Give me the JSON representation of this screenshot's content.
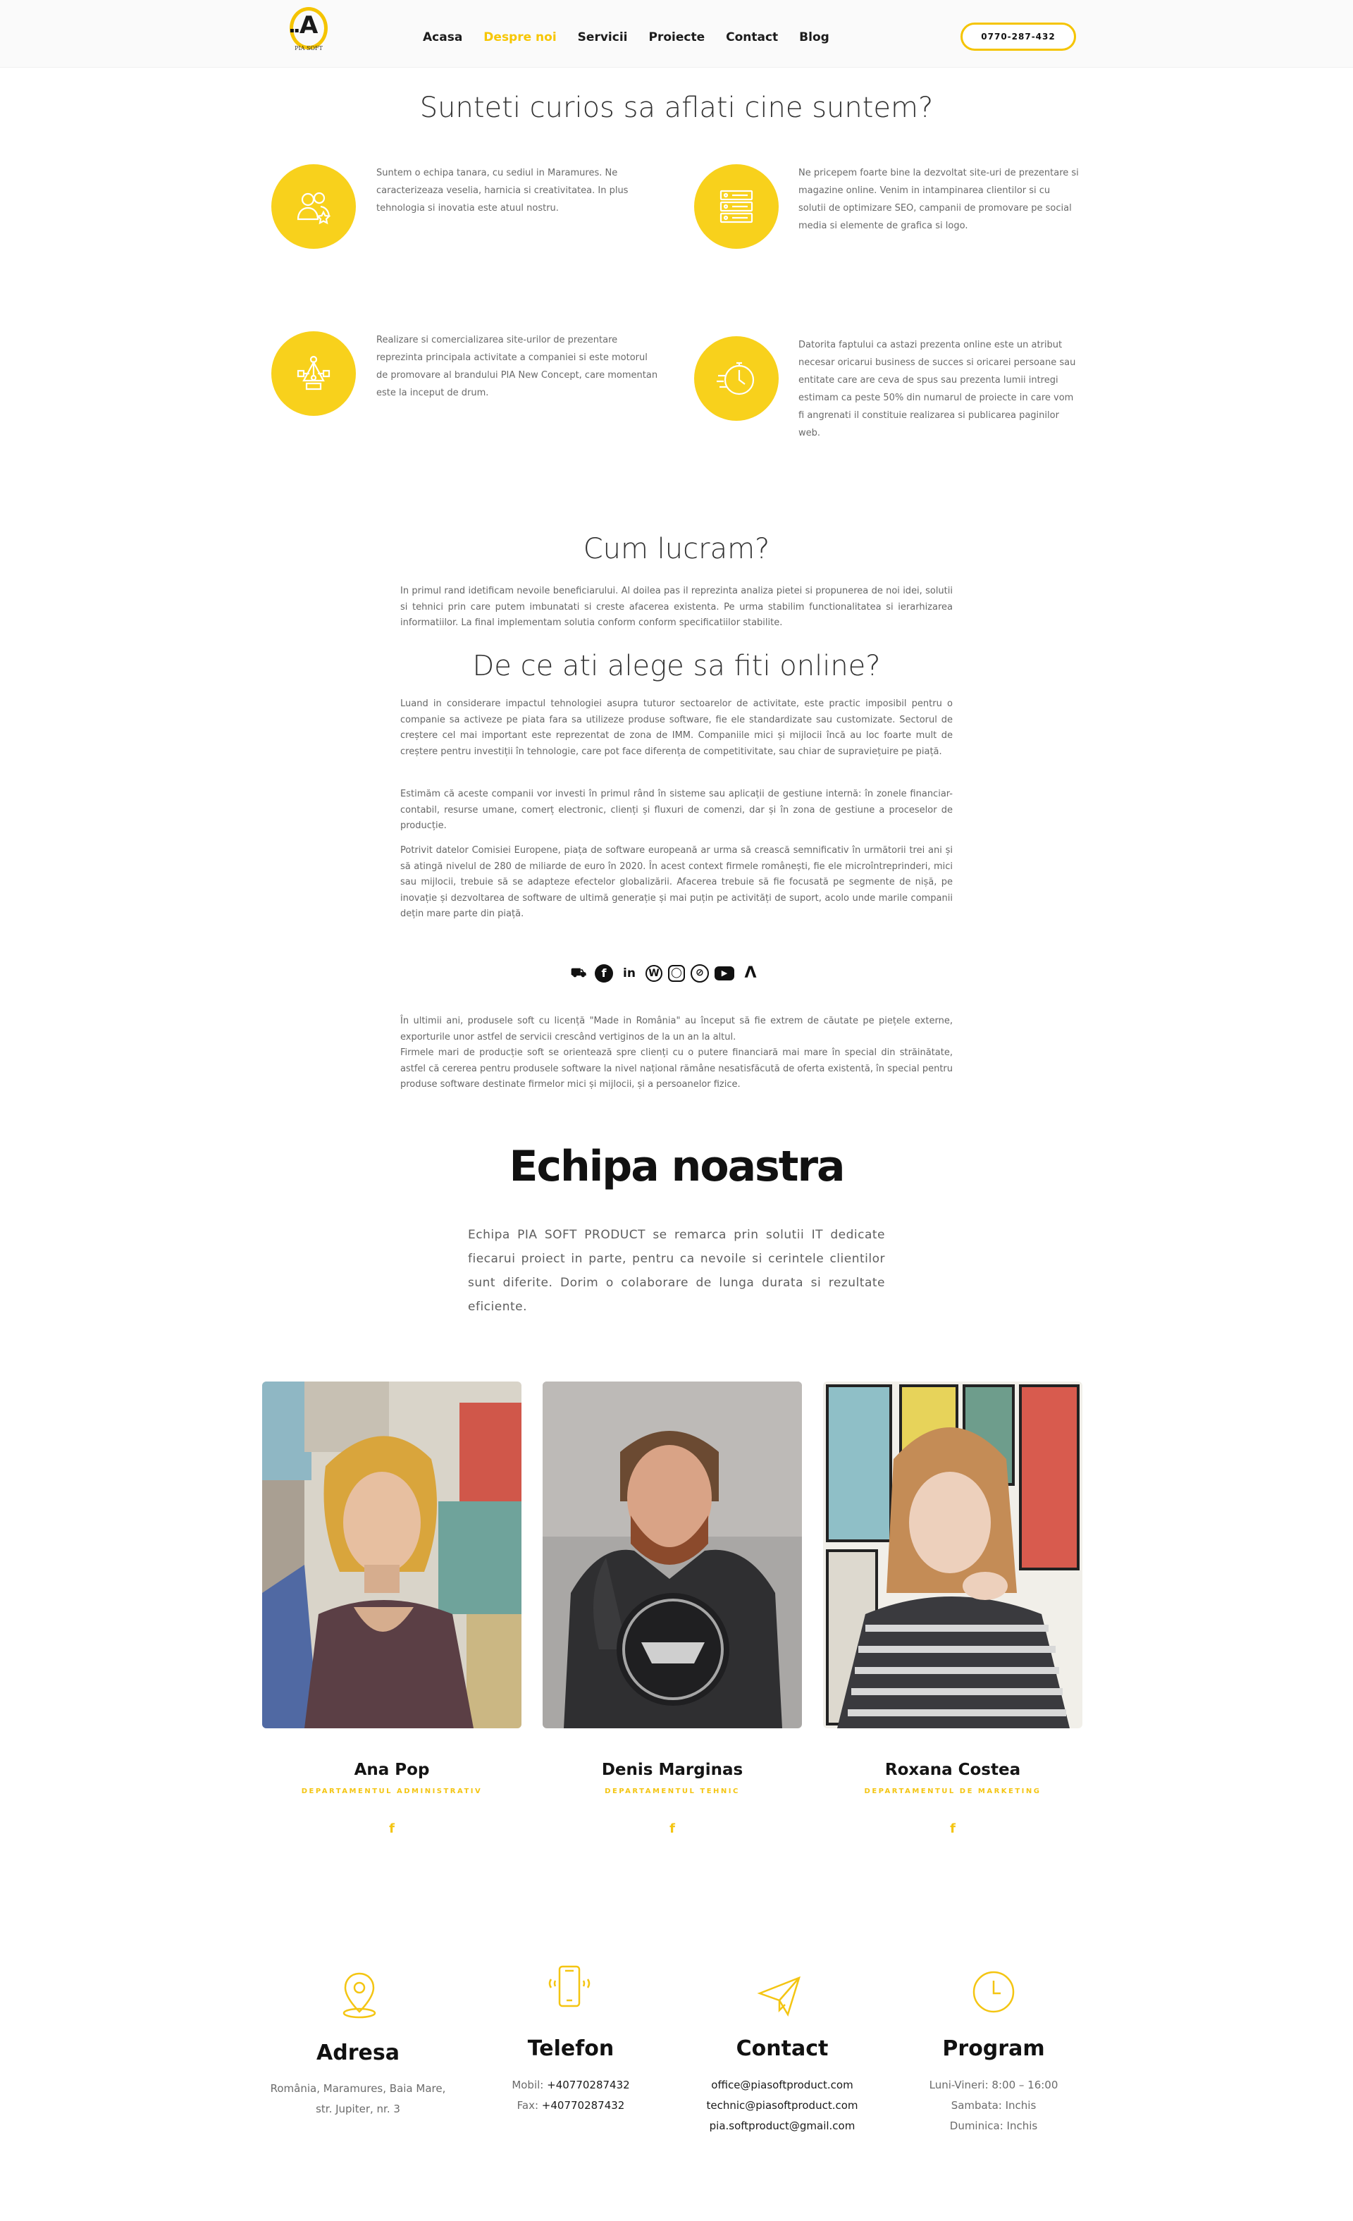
{
  "brand": {
    "logo_text": "PIA SOFT"
  },
  "nav": {
    "items": [
      "Acasa",
      "Despre noi",
      "Servicii",
      "Proiecte",
      "Contact",
      "Blog"
    ],
    "active_index": 1,
    "phone": "0770-287-432"
  },
  "colors": {
    "accent": "#f8d11c",
    "text_dark": "#1a1a1a",
    "text_muted": "#6a6a6a"
  },
  "about": {
    "title": "Sunteti curios sa aflati cine suntem?",
    "features": [
      {
        "icon": "team-star-icon",
        "text": "Suntem o echipa tanara, cu sediul in Maramures. Ne caracterizeaza veselia, harnicia si creativitatea. In plus tehnologia si inovatia este atuul nostru."
      },
      {
        "icon": "server-icon",
        "text": "Ne pricepem foarte bine la dezvoltat site-uri de prezentare si magazine online. Venim in intampinarea clientilor si cu solutii de optimizare SEO, campanii de promovare pe social media si elemente de grafica si logo."
      },
      {
        "icon": "design-tool-icon",
        "text": "Realizare si comercializarea site-urilor de prezentare reprezinta principala activitate a companiei si este motorul de promovare al brandului PIA New Concept, care momentan este la inceput de drum."
      },
      {
        "icon": "speed-clock-icon",
        "text": "Datorita faptului ca astazi prezenta online este un atribut necesar oricarui business de succes si oricarei persoane sau entitate care are ceva de spus sau prezenta lumii intregi estimam ca peste 50% din numarul de proiecte in care vom fi angrenati il constituie realizarea si publicarea paginilor web."
      }
    ]
  },
  "how": {
    "title": "Cum lucram?",
    "text": "In primul rand idetificam nevoile beneficiarului. Al doilea pas il reprezinta analiza pietei si propunerea de noi idei, solutii si tehnici prin care putem imbunatati si creste afacerea existenta. Pe urma stabilim functionalitatea si ierarhizarea informatiilor. La final implementam solutia conform conform specificatiilor stabilite."
  },
  "online": {
    "title": "De ce ati alege sa fiti online?",
    "paragraphs": [
      "Luand in considerare impactul tehnologiei asupra tuturor sectoarelor de activitate, este practic imposibil pentru o companie sa activeze pe piata fara sa utilizeze produse software, fie ele standardizate sau customizate. Sectorul de creștere cel mai important este reprezentat de zona de IMM. Companiile mici și mijlocii încă au loc foarte mult de creștere pentru investiții în tehnologie, care pot face diferența de competitivitate, sau chiar de supraviețuire pe piață.",
      "Estimăm că aceste companii vor investi în primul rând în sisteme sau aplicații de gestiune internă: în zonele financiar-contabil, resurse umane, comerț electronic, clienți și fluxuri de comenzi, dar și în zona de gestiune a proceselor de producție.",
      "Potrivit datelor Comisiei Europene, piața de software europeană ar urma să crească semnificativ în următorii trei ani și să atingă nivelul de 280 de miliarde de euro în 2020. În acest context firmele românești, fie ele microîntreprinderi, mici sau mijlocii, trebuie să se adapteze efectelor globalizării. Afacerea trebuie să fie focusată pe segmente de nișă, pe inovație și dezvoltarea de software de ultimă generație și mai puțin pe activități de suport, acolo unde marile companii dețin mare parte din piață."
    ],
    "social_icons": [
      "shop-icon",
      "facebook-icon",
      "linkedin-icon",
      "wordpress-icon",
      "instagram-icon",
      "compass-icon",
      "youtube-icon",
      "brand-a-icon"
    ],
    "paragraphs_after": [
      "În ultimii ani, produsele soft cu licență \"Made in România\" au început să fie extrem de căutate pe piețele externe, exporturile unor astfel de servicii crescând vertiginos de la un an la altul.",
      "Firmele mari de producție soft se orientează spre clienți cu o putere financiară mai mare în special din străinătate, astfel că cererea pentru produsele software la nivel național rămâne nesatisfăcută de oferta existentă, în special pentru produse software destinate firmelor mici și mijlocii, și a persoanelor fizice."
    ]
  },
  "team": {
    "title": "Echipa noastra",
    "description": "Echipa PIA SOFT PRODUCT se remarca prin solutii IT dedicate fiecarui proiect in parte, pentru ca nevoile si cerintele clientilor sunt diferite. Dorim o colaborare de lunga durata si rezultate eficiente.",
    "members": [
      {
        "name": "Ana Pop",
        "role": "DEPARTAMENTUL ADMINISTRATIV",
        "social": "f"
      },
      {
        "name": "Denis Marginas",
        "role": "DEPARTAMENTUL TEHNIC",
        "social": "f"
      },
      {
        "name": "Roxana Costea",
        "role": "DEPARTAMENTUL DE MARKETING",
        "social": "f"
      }
    ]
  },
  "contact": {
    "address": {
      "title": "Adresa",
      "lines": [
        "România, Maramures, Baia Mare,",
        "str. Jupiter, nr. 3"
      ]
    },
    "phone": {
      "title": "Telefon",
      "mobile_label": "Mobil:",
      "mobile": "+40770287432",
      "fax_label": "Fax:",
      "fax": "+40770287432"
    },
    "email": {
      "title": "Contact",
      "lines": [
        "office@piasoftproduct.com",
        "technic@piasoftproduct.com",
        "pia.softproduct@gmail.com"
      ]
    },
    "schedule": {
      "title": "Program",
      "lines": [
        "Luni-Vineri: 8:00 – 16:00",
        "Sambata: Inchis",
        "Duminica: Inchis"
      ]
    }
  }
}
